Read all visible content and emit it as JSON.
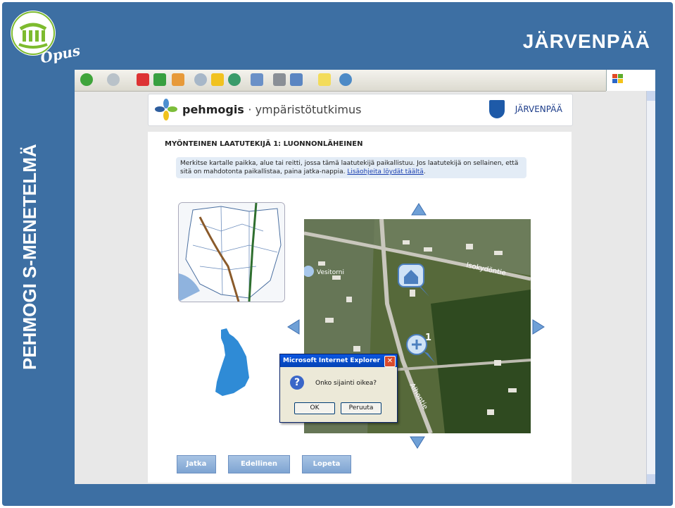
{
  "slide": {
    "title": "JÄRVENPÄÄ",
    "vertical_title": "PEHMOGI S-MENETELMÄ",
    "logo_text": "Opus"
  },
  "header": {
    "brand": "pehmogis",
    "brand_sub": "· ympäristötutkimus",
    "city": "JÄRVENPÄÄ"
  },
  "content": {
    "heading": "MYÖNTEINEN LAATUTEKIJÄ 1: LUONNONLÄHEINEN",
    "info_text": "Merkitse kartalle paikka, alue tai reitti, jossa tämä laatutekijä paikallistuu. Jos laatutekijä on sellainen, että sitä on mahdotonta paikallistaa, paina jatka-nappia.",
    "info_link": "Lisäohjeita löydät täältä"
  },
  "map": {
    "labels": {
      "vesitorni": "Vesitorni",
      "isokydontie": "Isokydöntie",
      "alhontie": "Alhontie"
    },
    "pin_badge": "1"
  },
  "dialog": {
    "title": "Microsoft Internet Explorer",
    "message": "Onko sijainti oikea?",
    "ok": "OK",
    "cancel": "Peruuta",
    "close": "✕",
    "icon": "?"
  },
  "nav": {
    "next": "Jatka",
    "prev": "Edellinen",
    "end": "Lopeta"
  },
  "icons": [
    "back-icon",
    "forward-icon",
    "stop-icon",
    "refresh-icon",
    "home-icon",
    "search-icon",
    "favorites-icon",
    "history-icon",
    "mail-icon",
    "print-icon",
    "edit-icon",
    "discuss-icon",
    "messenger-icon"
  ],
  "colors": {
    "slide_bg": "#3d6fa3",
    "button": "#7ea4d2",
    "info_bg": "#e3ecf6",
    "dialog_title": "#0a56e1"
  }
}
